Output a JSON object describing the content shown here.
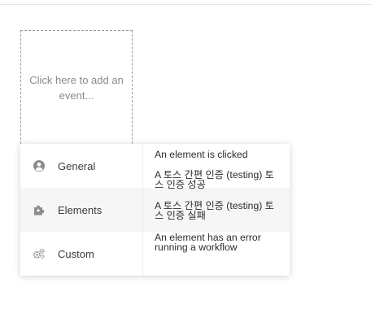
{
  "add_event": {
    "placeholder_text": "Click here to add an event..."
  },
  "menu": {
    "categories": [
      {
        "label": "General",
        "icon": "user-circle-icon"
      },
      {
        "label": "Elements",
        "icon": "puzzle-plus-icon"
      },
      {
        "label": "Custom",
        "icon": "gears-icon"
      }
    ],
    "events": [
      {
        "label": "An element is clicked"
      },
      {
        "label": "A 토스 간편 인증 (testing) 토스 인증 성공"
      },
      {
        "label": "A 토스 간편 인증 (testing) 토스 인증 실패"
      },
      {
        "label": "An element has an error running a workflow"
      }
    ],
    "active_category": "Elements"
  }
}
